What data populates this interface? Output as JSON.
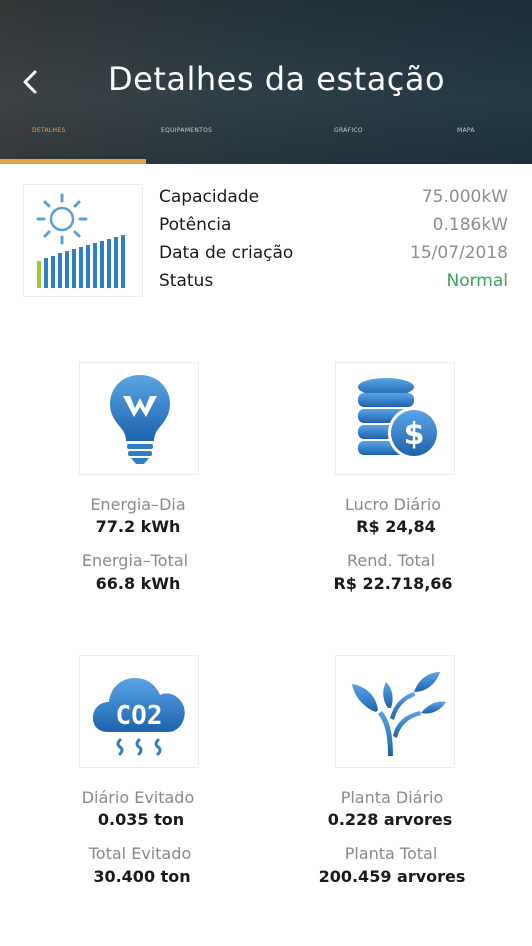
{
  "header": {
    "title": "Detalhes da estação",
    "tabs": [
      {
        "label": "DETALHES"
      },
      {
        "label": "EQUIPAMENTOS"
      },
      {
        "label": "GRÁFICO"
      },
      {
        "label": "MAPA"
      }
    ],
    "colors": {
      "accent": "#e0a24d"
    }
  },
  "station": {
    "rows": [
      {
        "label": "Capacidade",
        "value": "75.000kW"
      },
      {
        "label": "Potência",
        "value": "0.186kW"
      },
      {
        "label": "Data de criação",
        "value": "15/07/2018"
      },
      {
        "label": "Status",
        "value": "Normal"
      }
    ],
    "status_color": "#3aa55a"
  },
  "stats": {
    "energy": {
      "icon": "lightbulb-icon",
      "day_label": "Energia–Dia",
      "day_value": "77.2 kWh",
      "total_label": "Energia–Total",
      "total_value": "66.8 kWh"
    },
    "profit": {
      "icon": "coins-dollar-icon",
      "day_label": "Lucro Diário",
      "day_value": "R$ 24,84",
      "total_label": "Rend. Total",
      "total_value": "R$ 22.718,66"
    },
    "co2": {
      "icon": "co2-cloud-icon",
      "icon_text": "CO2",
      "day_label": "Diário Evitado",
      "day_value": "0.035 ton",
      "total_label": "Total Evitado",
      "total_value": "30.400 ton"
    },
    "plant": {
      "icon": "plant-icon",
      "day_label": "Planta Diário",
      "day_value": "0.228 arvores",
      "total_label": "Planta Total",
      "total_value": "200.459 arvores"
    }
  }
}
